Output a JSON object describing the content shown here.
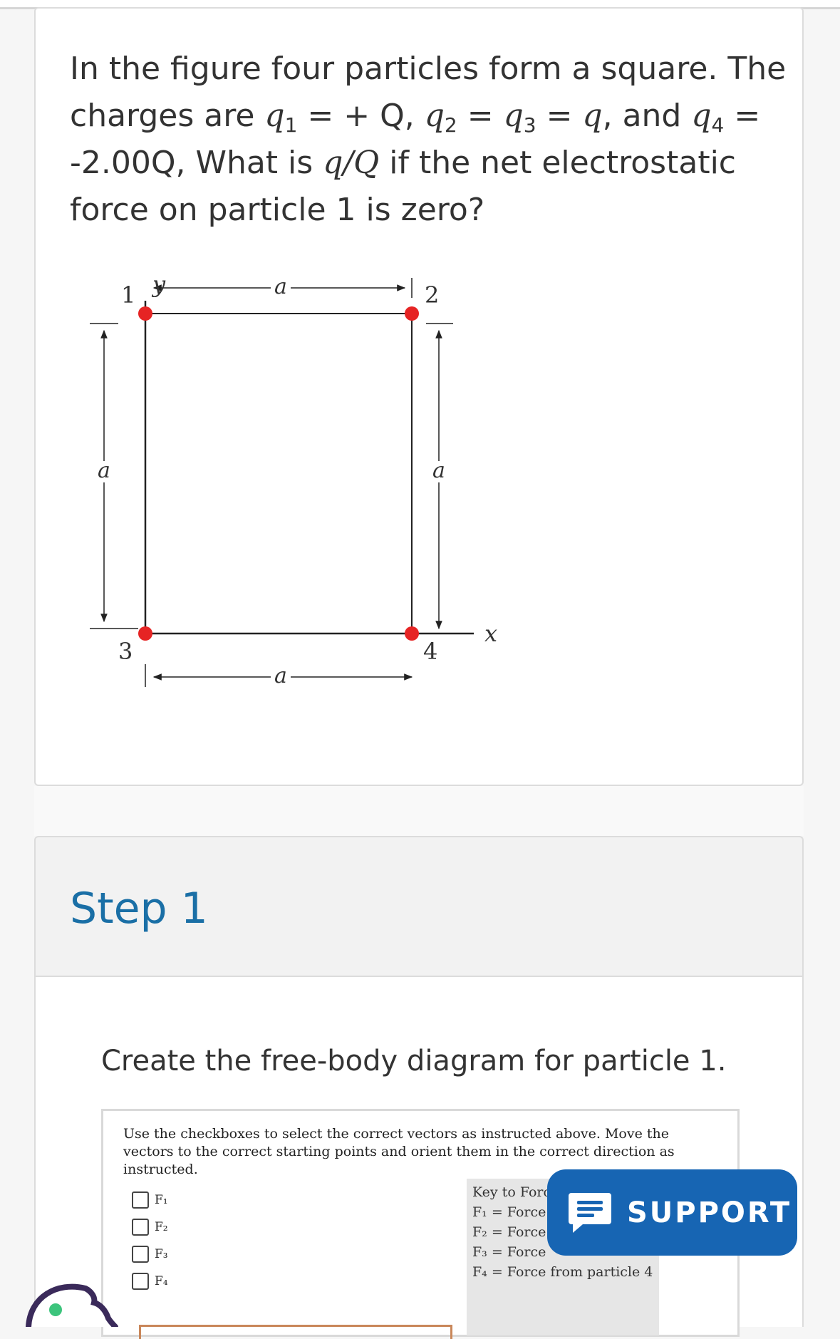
{
  "question": {
    "text_1": "In the figure four particles form a square. The charges are ",
    "q1": "q",
    "q1_sub": "1",
    "text_2": " = + Q, ",
    "q2": "q",
    "q2_sub": "2",
    "text_3": " = ",
    "q3": "q",
    "q3_sub": "3",
    "text_4": " = ",
    "q_var": "q",
    "text_5": ", and ",
    "q4": "q",
    "q4_sub": "4",
    "text_6": " = -2.00Q, What is ",
    "ratio": "q/Q",
    "text_7": " if the net electrostatic force on particle 1 is zero?"
  },
  "figure": {
    "axis_y": "y",
    "axis_x": "x",
    "side_label": "a",
    "particle_labels": [
      "1",
      "2",
      "3",
      "4"
    ],
    "particle_color": "#e62424"
  },
  "step": {
    "title": "Step 1",
    "instruction": "Create the free-body diagram for particle 1."
  },
  "widget": {
    "instructions": "Use the checkboxes to select the correct vectors as instructed above. Move the vectors to the correct starting points and orient them in the correct direction as instructed.",
    "checkboxes": [
      "F₁",
      "F₂",
      "F₃",
      "F₄"
    ],
    "key_title": "Key to Forc",
    "key_items": [
      "F₁ = Force",
      "F₂ = Force",
      "F₃ = Force",
      "F₄ = Force from particle 4"
    ]
  },
  "support": {
    "label": "SUPPORT",
    "icon": "chat-message-icon",
    "color": "#1765b3"
  },
  "colors": {
    "step_title": "#1a6fa6"
  }
}
